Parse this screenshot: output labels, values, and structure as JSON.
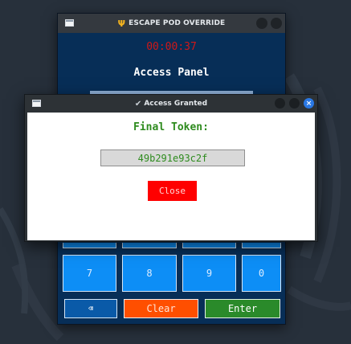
{
  "back_window": {
    "title": "ESCAPE POD OVERRIDE",
    "title_icon": "trident-icon",
    "timer": "00:00:37",
    "panel_title": "Access Panel",
    "keypad": [
      "7",
      "8",
      "9",
      "0"
    ],
    "backspace_label": "⌫",
    "clear_label": "Clear",
    "enter_label": "Enter"
  },
  "dialog": {
    "title": "Access Granted",
    "title_icon": "check-icon",
    "heading": "Final Token:",
    "token_value": "49b291e93c2f",
    "close_label": "Close",
    "close_icon": "×"
  },
  "colors": {
    "desktop": "#27303b",
    "panel": "#072e57",
    "timer": "#d01818",
    "keypad": "#0d8ef6",
    "clear_button": "#ff4f00",
    "enter_button": "#2a8a2a",
    "token_text": "#2e8b1e",
    "close_button": "#ff0000"
  }
}
